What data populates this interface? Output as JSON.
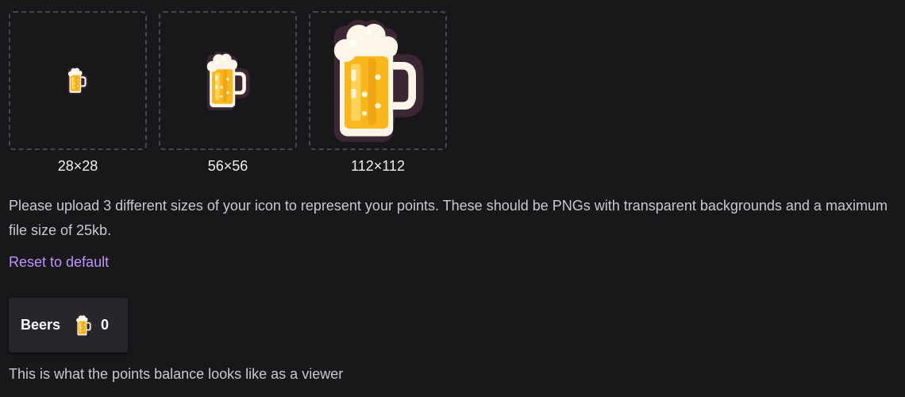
{
  "icon_upload": {
    "slots": [
      {
        "size_label": "28×28",
        "icon": "beer-mug-icon"
      },
      {
        "size_label": "56×56",
        "icon": "beer-mug-icon"
      },
      {
        "size_label": "112×112",
        "icon": "beer-mug-icon"
      }
    ]
  },
  "help_text": "Please upload 3 different sizes of your icon to represent your points. These should be PNGs with transparent backgrounds and a maximum file size of 25kb.",
  "reset_link": "Reset to default",
  "balance_preview": {
    "points_name": "Beers",
    "icon": "beer-mug-icon",
    "value": "0"
  },
  "preview_note": "This is what the points balance looks like as a viewer",
  "colors": {
    "background": "#18181b",
    "accent": "#bf94ff",
    "card": "#26262c",
    "beer": "#f7b71d",
    "foam": "#fdf5e8"
  }
}
